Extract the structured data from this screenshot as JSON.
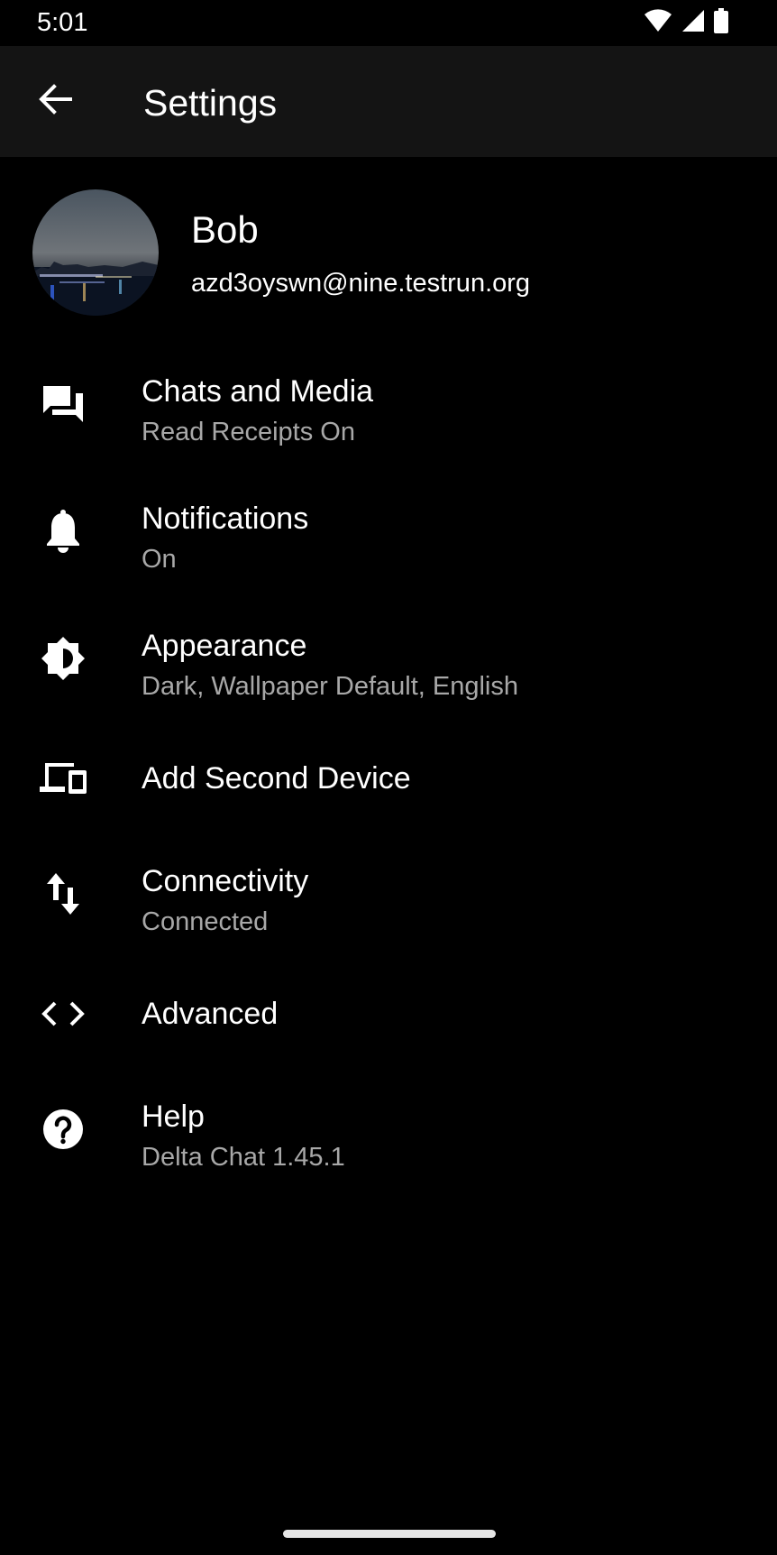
{
  "status_bar": {
    "time": "5:01",
    "icons": [
      "wifi-icon",
      "cellular-signal-icon",
      "battery-icon"
    ]
  },
  "app_bar": {
    "title": "Settings",
    "back_icon": "arrow-left-icon"
  },
  "profile": {
    "name": "Bob",
    "email": "azd3oyswn@nine.testrun.org",
    "avatar_description": "night-harbor-photo"
  },
  "settings": {
    "items": [
      {
        "title": "Chats and Media",
        "summary": "Read Receipts On",
        "icon": "forum-icon"
      },
      {
        "title": "Notifications",
        "summary": "On",
        "icon": "bell-icon"
      },
      {
        "title": "Appearance",
        "summary": "Dark, Wallpaper Default, English",
        "icon": "brightness-icon"
      },
      {
        "title": "Add Second Device",
        "icon": "devices-icon"
      },
      {
        "title": "Connectivity",
        "summary": "Connected",
        "icon": "swap-vert-icon"
      },
      {
        "title": "Advanced",
        "icon": "code-icon"
      },
      {
        "title": "Help",
        "summary": "Delta Chat 1.45.1",
        "icon": "help-icon"
      }
    ]
  },
  "colors": {
    "background": "#000000",
    "app_bar": "#141414",
    "primary_text": "#ffffff",
    "secondary_text": "#a8a8a8"
  }
}
